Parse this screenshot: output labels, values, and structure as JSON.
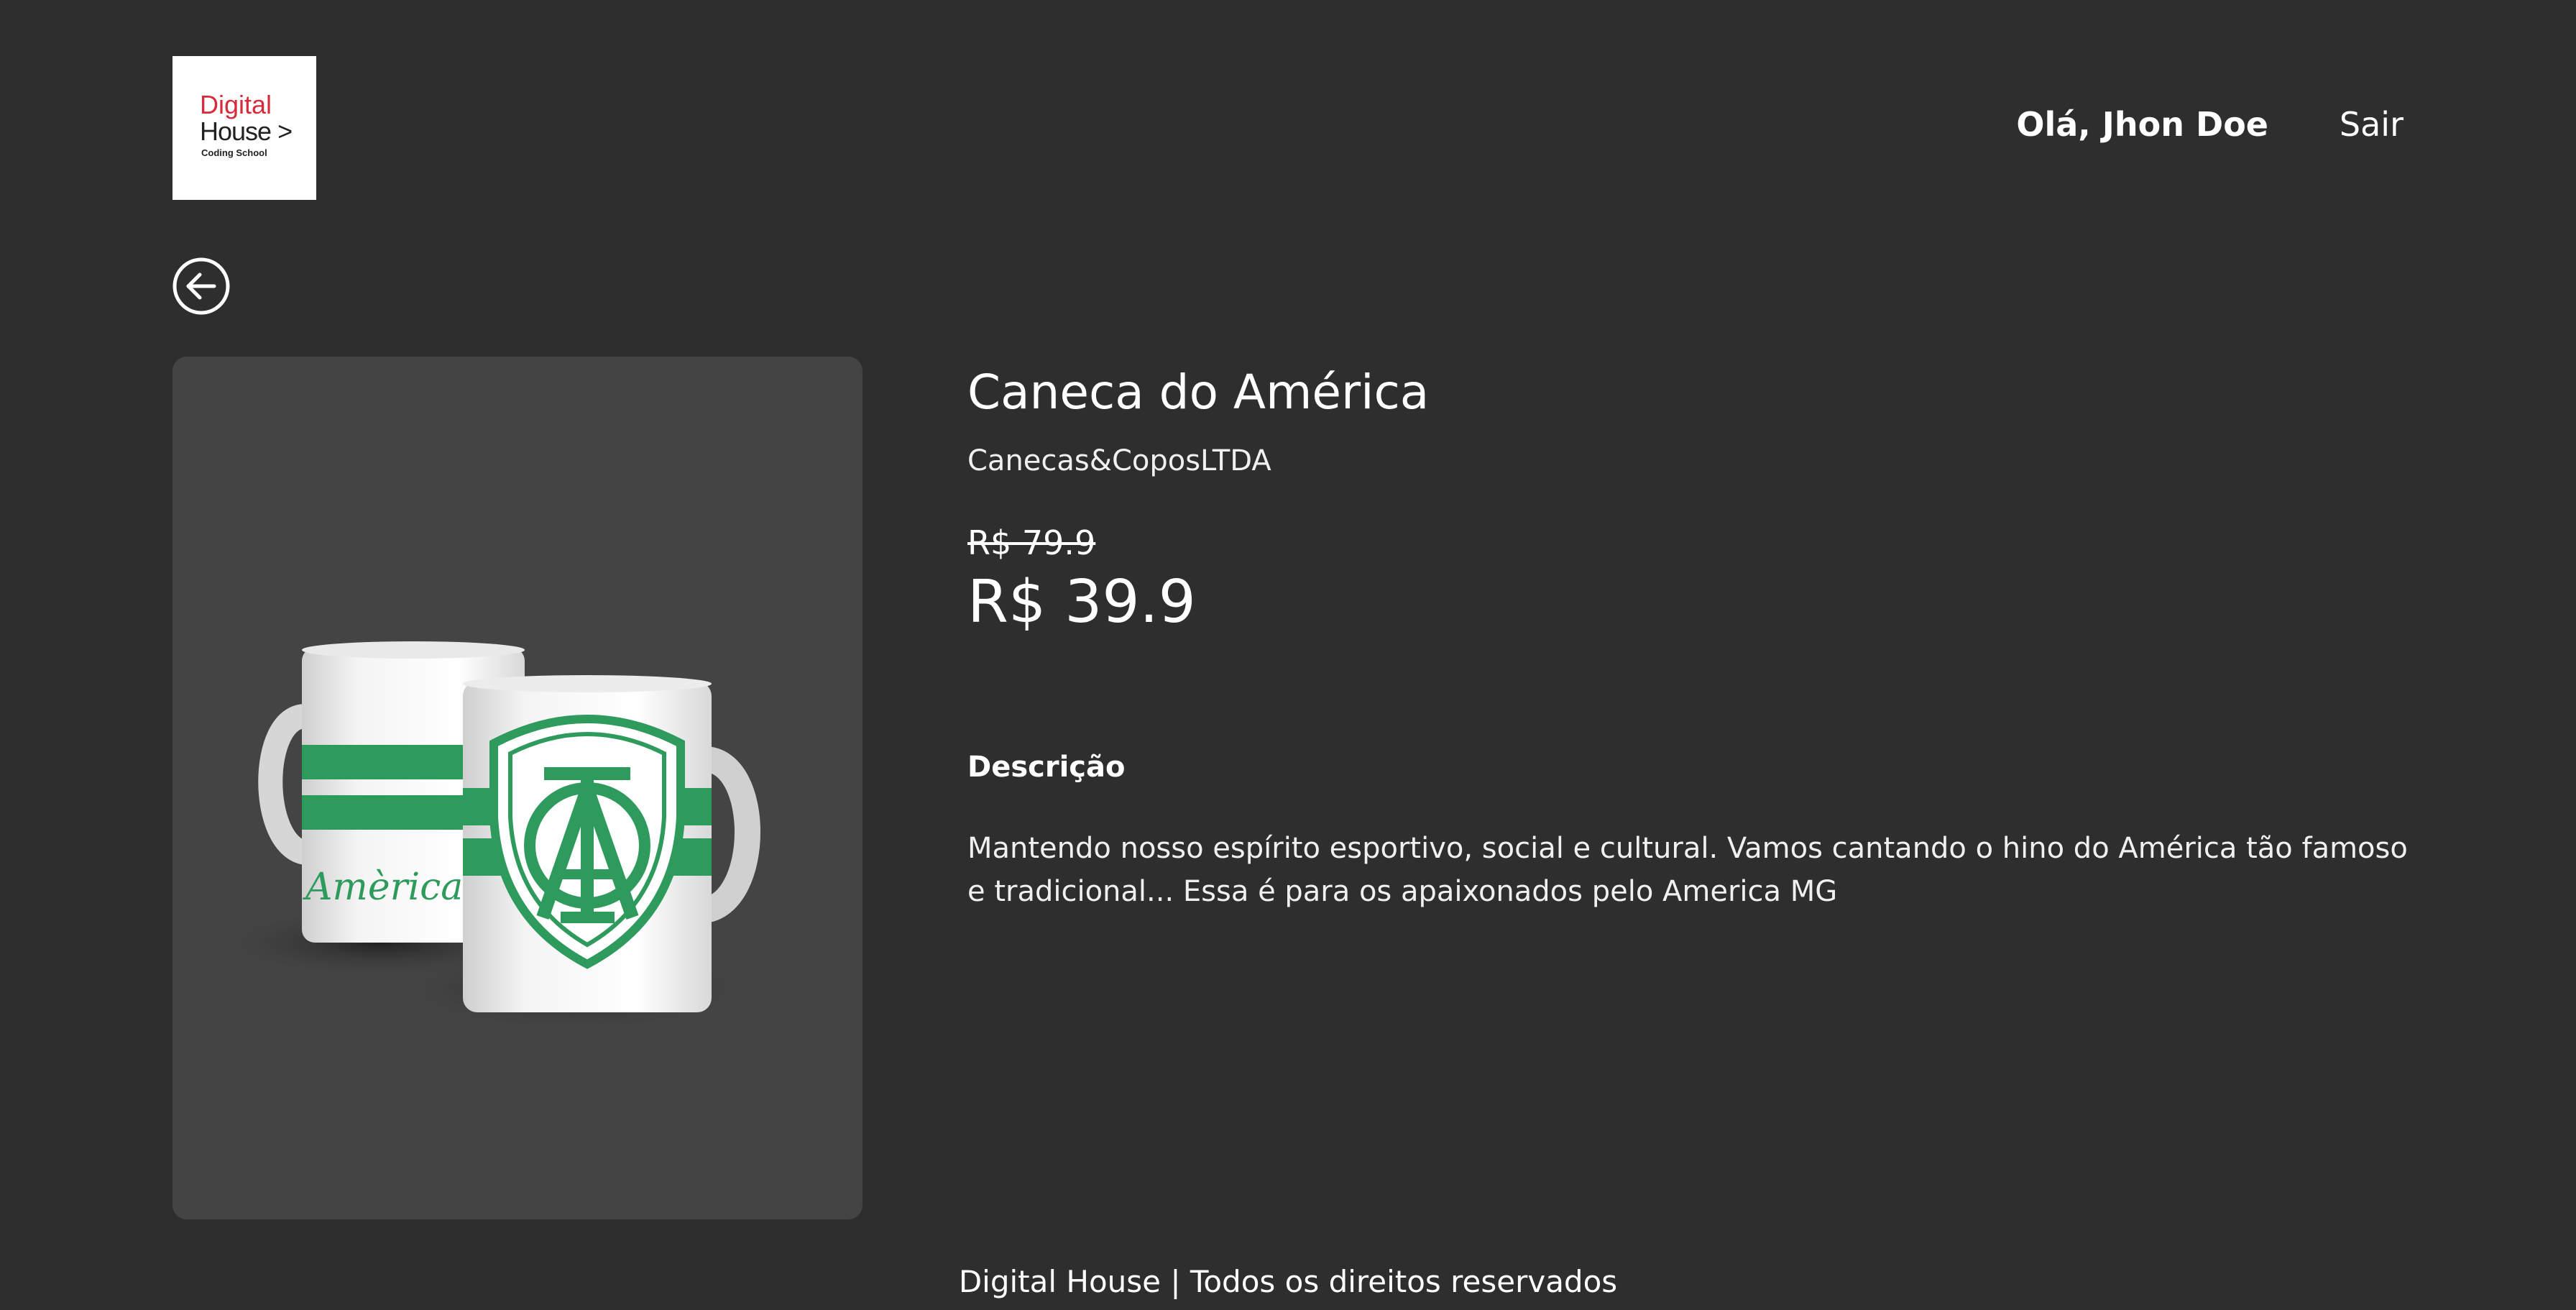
{
  "header": {
    "logo": {
      "line1": "Digital",
      "line2": "House >",
      "line3": "Coding School"
    },
    "greeting": "Olá, Jhon Doe",
    "logout_label": "Sair"
  },
  "navigation": {
    "back_icon": "arrow-left-circle-icon"
  },
  "product": {
    "image_caption": "Amèrica",
    "title": "Caneca do América",
    "seller": "Canecas&CoposLTDA",
    "old_price": "R$ 79.9",
    "price": "R$ 39.9",
    "description_heading": "Descrição",
    "description": "Mantendo nosso espírito esportivo, social e cultural. Vamos cantando o hino do América tão famoso e tradicional... Essa é para os apaixonados pelo America MG"
  },
  "footer": {
    "text": "Digital House | Todos os direitos reservados"
  },
  "colors": {
    "background": "#2e2e2e",
    "image_panel": "#444444",
    "brand_red": "#d52b3a",
    "mug_green": "#2e9a5c"
  }
}
